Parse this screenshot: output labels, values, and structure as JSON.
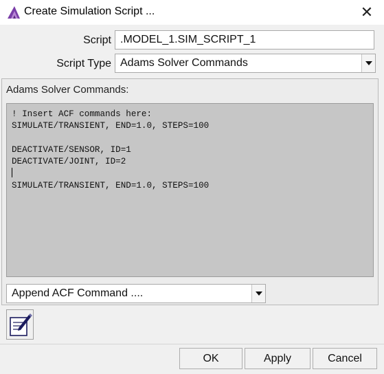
{
  "window": {
    "title": "Create Simulation Script ...",
    "close_symbol": "✕"
  },
  "form": {
    "script_label": "Script",
    "script_value": ".MODEL_1.SIM_SCRIPT_1",
    "script_type_label": "Script Type",
    "script_type_value": "Adams Solver Commands"
  },
  "commands_panel": {
    "label": "Adams Solver Commands:",
    "lines": [
      "! Insert ACF commands here:",
      "SIMULATE/TRANSIENT, END=1.0, STEPS=100",
      "",
      "DEACTIVATE/SENSOR, ID=1",
      "DEACTIVATE/JOINT, ID=2",
      "",
      "SIMULATE/TRANSIENT, END=1.0, STEPS=100"
    ],
    "caret_line": 5
  },
  "append_select": {
    "value": "Append ACF Command ...."
  },
  "buttons": {
    "ok": "OK",
    "apply": "Apply",
    "cancel": "Cancel"
  },
  "icons": {
    "app": "adams-logo-icon",
    "editor": "edit-notepad-icon",
    "close": "close-icon",
    "dropdown": "chevron-down-icon"
  },
  "colors": {
    "dialog_bg": "#f0f0f0",
    "command_area_bg": "#c6c6c6",
    "logo_purple": "#7a3ea8"
  }
}
